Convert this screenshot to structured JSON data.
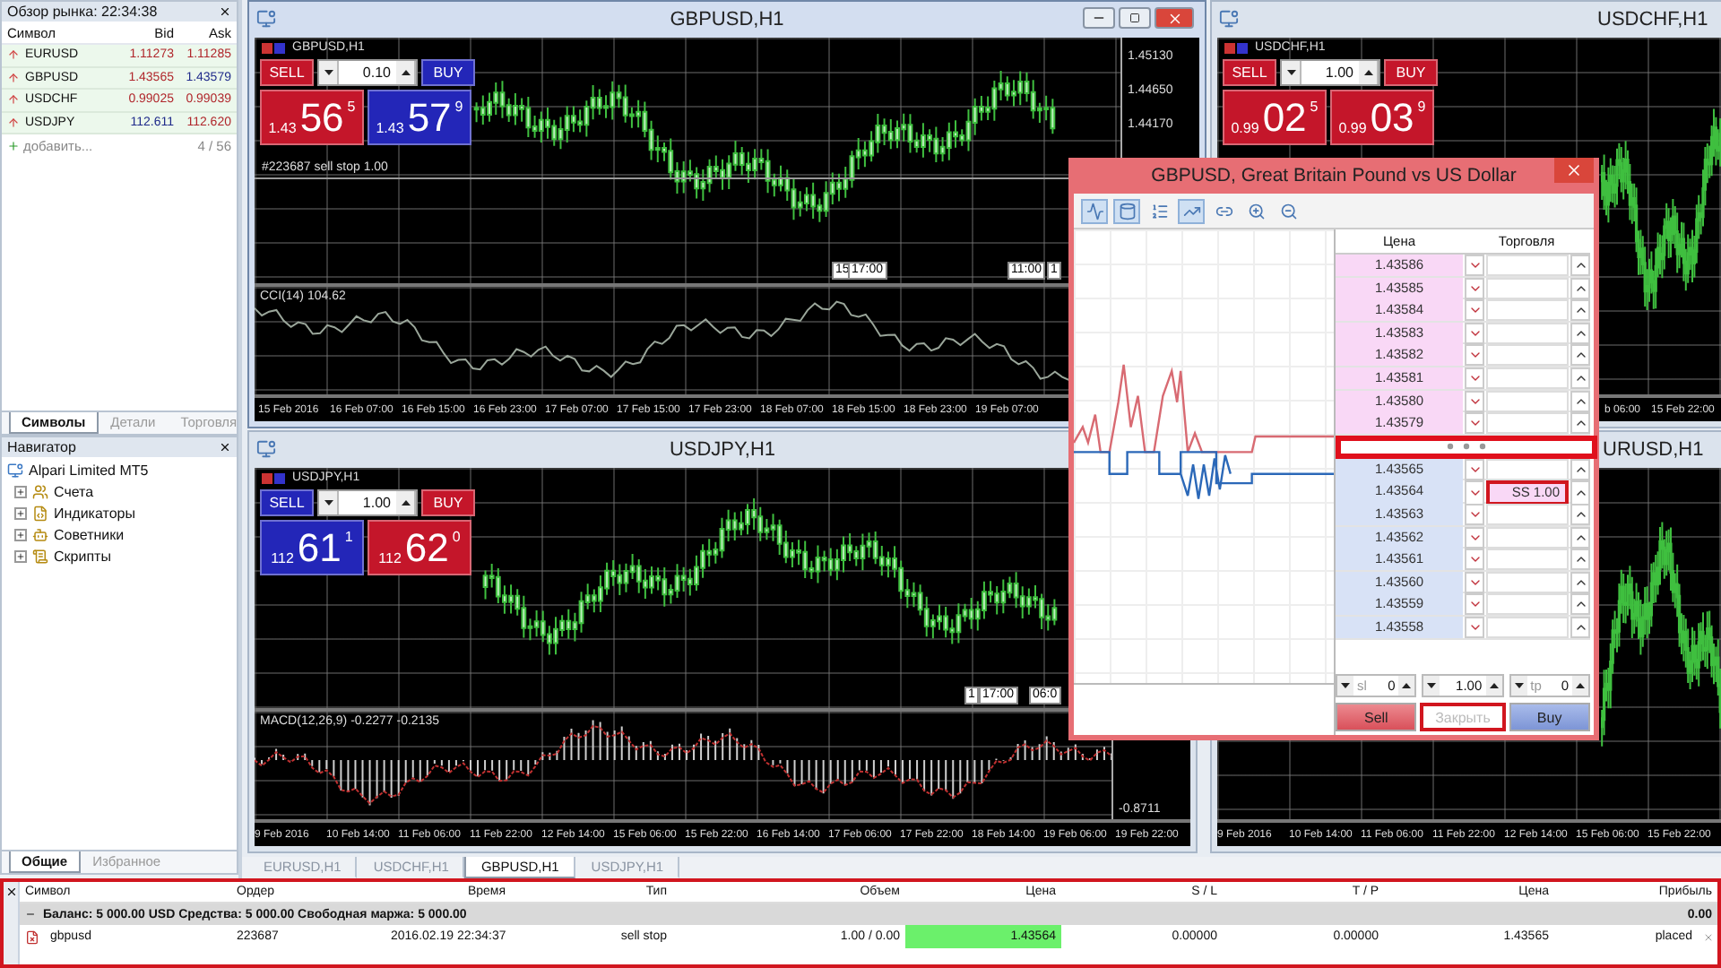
{
  "market_watch": {
    "title": "Обзор рынка: 22:34:38",
    "columns": [
      "Символ",
      "Bid",
      "Ask"
    ],
    "rows": [
      {
        "symbol": "EURUSD",
        "bid": {
          "text": "1.11273",
          "color": "#b0262b"
        },
        "ask": {
          "text": "1.11285",
          "color": "#b0262b"
        }
      },
      {
        "symbol": "GBPUSD",
        "bid": {
          "text": "1.43565",
          "color": "#b0262b"
        },
        "ask": {
          "text": "1.43579",
          "color": "#1f2a8a"
        }
      },
      {
        "symbol": "USDCHF",
        "bid": {
          "text": "0.99025",
          "color": "#b0262b"
        },
        "ask": {
          "text": "0.99039",
          "color": "#b0262b"
        }
      },
      {
        "symbol": "USDJPY",
        "bid": {
          "text": "112.611",
          "color": "#1f2a8a"
        },
        "ask": {
          "text": "112.620",
          "color": "#b0262b"
        }
      }
    ],
    "add_label": "добавить...",
    "count": "4 / 56",
    "tabs": [
      {
        "label": "Символы",
        "selected": true
      },
      {
        "label": "Детали",
        "selected": false
      },
      {
        "label": "Торговля",
        "selected": false
      }
    ]
  },
  "navigator": {
    "title": "Навигатор",
    "root": {
      "label": "Alpari Limited MT5",
      "children": [
        {
          "label": "Счета",
          "kind": "accounts",
          "expanded": false
        },
        {
          "label": "Индикаторы",
          "kind": "indicators",
          "expanded": false
        },
        {
          "label": "Советники",
          "kind": "experts",
          "expanded": false
        },
        {
          "label": "Скрипты",
          "kind": "scripts",
          "expanded": false
        }
      ]
    },
    "tabs": [
      {
        "label": "Общие",
        "selected": true
      },
      {
        "label": "Избранное",
        "selected": false
      }
    ]
  },
  "charts": [
    {
      "title": "GBPUSD,H1",
      "active": true,
      "label": "GBPUSD,H1",
      "trade": {
        "lot": "0.10",
        "sell": {
          "label": "SELL",
          "prefix": "1.43",
          "big": "56",
          "sup": "5",
          "color": "#c4162a"
        },
        "buy": {
          "label": "BUY",
          "prefix": "1.43",
          "big": "57",
          "sup": "9",
          "color": "#2326b8"
        }
      },
      "price_ticks": [
        "1.45130",
        "1.44650",
        "1.44170"
      ],
      "order_line": "#223687 sell stop 1.00",
      "time_markers": [
        "15",
        "17:00",
        "11:00",
        "1"
      ],
      "indicator": {
        "kind": "line",
        "label": "CCI(14) 104.62"
      },
      "x_labels": [
        "15 Feb 2016",
        "16 Feb 07:00",
        "16 Feb 15:00",
        "16 Feb 23:00",
        "17 Feb 07:00",
        "17 Feb 15:00",
        "17 Feb 23:00",
        "18 Feb 07:00",
        "18 Feb 15:00",
        "18 Feb 23:00",
        "19 Feb 07:00"
      ]
    },
    {
      "title": "USDCHF,H1",
      "active": false,
      "label": "USDCHF,H1",
      "trade": {
        "lot": "1.00",
        "sell": {
          "label": "SELL",
          "prefix": "0.99",
          "big": "02",
          "sup": "5",
          "color": "#c4162a"
        },
        "buy": {
          "label": "BUY",
          "prefix": "0.99",
          "big": "03",
          "sup": "9",
          "color": "#c4162a"
        }
      },
      "x_labels": [
        "b 06:00",
        "15 Feb 22:00"
      ]
    },
    {
      "title": "USDJPY,H1",
      "active": false,
      "label": "USDJPY,H1",
      "trade": {
        "lot": "1.00",
        "sell": {
          "label": "SELL",
          "prefix": "112",
          "big": "61",
          "sup": "1",
          "color": "#2326b8"
        },
        "buy": {
          "label": "BUY",
          "prefix": "112",
          "big": "62",
          "sup": "0",
          "color": "#c4162a"
        }
      },
      "time_markers": [
        "1",
        "17:00",
        "06:0"
      ],
      "indicator": {
        "kind": "histogram",
        "label": "MACD(12,26,9) -0.2277 -0.2135",
        "ticks": [
          "-0.8711"
        ]
      },
      "x_labels": [
        "9 Feb 2016",
        "10 Feb 14:00",
        "11 Feb 06:00",
        "11 Feb 22:00",
        "12 Feb 14:00",
        "15 Feb 06:00",
        "15 Feb 22:00",
        "16 Feb 14:00",
        "17 Feb 06:00",
        "17 Feb 22:00",
        "18 Feb 14:00",
        "19 Feb 06:00",
        "19 Feb 22:00"
      ]
    },
    {
      "title": "URUSD,H1",
      "active": false,
      "x_labels": [
        "9 Feb 2016",
        "10 Feb 14:00",
        "11 Feb 06:00",
        "11 Feb 22:00",
        "12 Feb 14:00",
        "15 Feb 06:00",
        "15 Feb 22:00"
      ]
    }
  ],
  "chart_tabs": [
    {
      "label": "EURUSD,H1",
      "selected": false
    },
    {
      "label": "USDCHF,H1",
      "selected": false
    },
    {
      "label": "GBPUSD,H1",
      "selected": true
    },
    {
      "label": "USDJPY,H1",
      "selected": false
    }
  ],
  "depth_dialog": {
    "title": "GBPUSD, Great Britain Pound vs US Dollar",
    "toolbar": [
      {
        "kind": "chart",
        "selected": true
      },
      {
        "kind": "volume",
        "selected": true
      },
      {
        "kind": "levels",
        "selected": false
      },
      {
        "kind": "ticks",
        "selected": true
      },
      {
        "kind": "link",
        "selected": false
      },
      {
        "kind": "zoom_in",
        "selected": false
      },
      {
        "kind": "zoom_out",
        "selected": false
      }
    ],
    "columns": [
      "Цена",
      "Торговля"
    ],
    "ask_rows": [
      {
        "price": "1.43586"
      },
      {
        "price": "1.43585"
      },
      {
        "price": "1.43584"
      },
      {
        "price": "1.43583"
      },
      {
        "price": "1.43582"
      },
      {
        "price": "1.43581"
      },
      {
        "price": "1.43580"
      },
      {
        "price": "1.43579"
      }
    ],
    "separator_highlighted": true,
    "bid_rows": [
      {
        "price": "1.43565"
      },
      {
        "price": "1.43564",
        "order": "SS 1.00",
        "highlighted": true
      },
      {
        "price": "1.43563"
      },
      {
        "price": "1.43562"
      },
      {
        "price": "1.43561"
      },
      {
        "price": "1.43560"
      },
      {
        "price": "1.43559"
      },
      {
        "price": "1.43558"
      }
    ],
    "sl": {
      "label": "sl",
      "value": "0"
    },
    "volume": "1.00",
    "tp": {
      "label": "tp",
      "value": "0"
    },
    "buttons": [
      {
        "kind": "sell",
        "label": "Sell",
        "disabled": false,
        "highlighted": false
      },
      {
        "kind": "close",
        "label": "Закрыть",
        "disabled": true,
        "highlighted": true
      },
      {
        "kind": "buy",
        "label": "Buy",
        "disabled": false,
        "highlighted": false
      }
    ]
  },
  "terminal": {
    "highlighted": true,
    "columns": [
      "Символ",
      "Ордер",
      "Время",
      "Тип",
      "Объем",
      "Цена",
      "S / L",
      "T / P",
      "Цена",
      "Прибыль"
    ],
    "balance": {
      "text": "Баланс: 5 000.00 USD  Средства: 5 000.00  Свободная маржа: 5 000.00",
      "profit": "0.00"
    },
    "orders": [
      {
        "cells": [
          "gbpusd",
          "223687",
          "2016.02.19 22:34:37",
          "sell stop",
          "1.00 / 0.00",
          "1.43564",
          "0.00000",
          "0.00000",
          "1.43565",
          "placed"
        ],
        "price_highlighted": true
      }
    ]
  }
}
